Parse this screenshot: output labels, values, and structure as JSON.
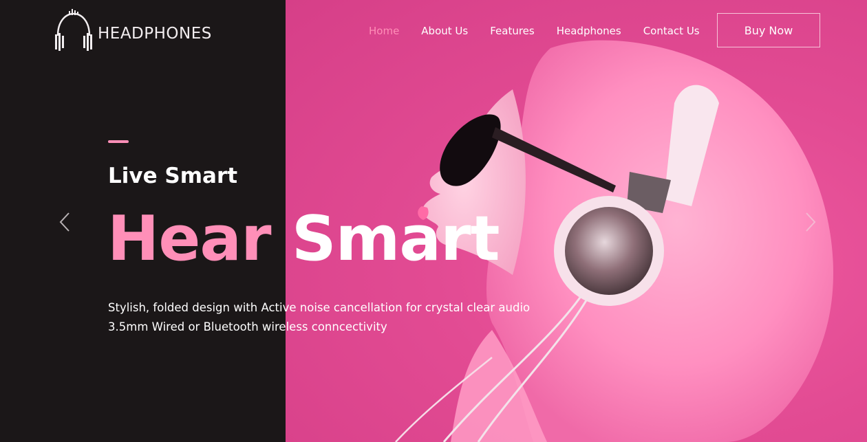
{
  "brand": {
    "logo_text": "HEADPHONES"
  },
  "nav": {
    "items": [
      {
        "label": "Home",
        "active": true
      },
      {
        "label": "About Us",
        "active": false
      },
      {
        "label": "Features",
        "active": false
      },
      {
        "label": "Headphones",
        "active": false
      },
      {
        "label": "Contact Us",
        "active": false
      }
    ],
    "cta_label": "Buy Now"
  },
  "hero": {
    "kicker": "Live Smart",
    "headline_part1": "Hear",
    "headline_part2": "Smart",
    "description": "Stylish, folded design with Active noise cancellation for crystal clear audio 3.5mm Wired or Bluetooth wireless conncectivity"
  },
  "carousel": {
    "prev_icon": "chevron-left-icon",
    "next_icon": "chevron-right-icon"
  },
  "colors": {
    "accent": "#ff8fb8",
    "dark_panel": "#1b1718",
    "pink_background": "#e24b93",
    "text": "#ffffff"
  }
}
